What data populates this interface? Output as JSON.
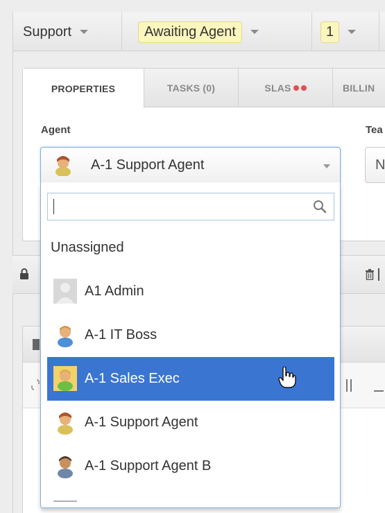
{
  "toolbar": {
    "department": "Support",
    "status": "Awaiting Agent",
    "urgency": "1"
  },
  "tabs": [
    {
      "label": "PROPERTIES"
    },
    {
      "label": "TASKS (0)"
    },
    {
      "label": "SLAS"
    },
    {
      "label": "BILLIN"
    }
  ],
  "fields": {
    "agent_label": "Agent",
    "team_label": "Tea",
    "agent_value": "A-1 Support Agent",
    "team_value": "N"
  },
  "search": {
    "placeholder": "",
    "value": ""
  },
  "options": [
    {
      "label": "Unassigned",
      "avatar": "none"
    },
    {
      "label": "A1 Admin",
      "avatar": "default-avatar"
    },
    {
      "label": "A-1 IT Boss",
      "avatar": "agent-blue"
    },
    {
      "label": "A-1 Sales Exec",
      "avatar": "agent-green",
      "selected": true
    },
    {
      "label": "A-1 Support Agent",
      "avatar": "agent-brown"
    },
    {
      "label": "A-1 Support Agent B",
      "avatar": "agent-dark"
    }
  ],
  "colors": {
    "selected_bg": "#3a75d2",
    "status_chip_bg": "#fbf6bd",
    "sla_dot": "#e05050",
    "focus_border": "#7fb0e0"
  }
}
